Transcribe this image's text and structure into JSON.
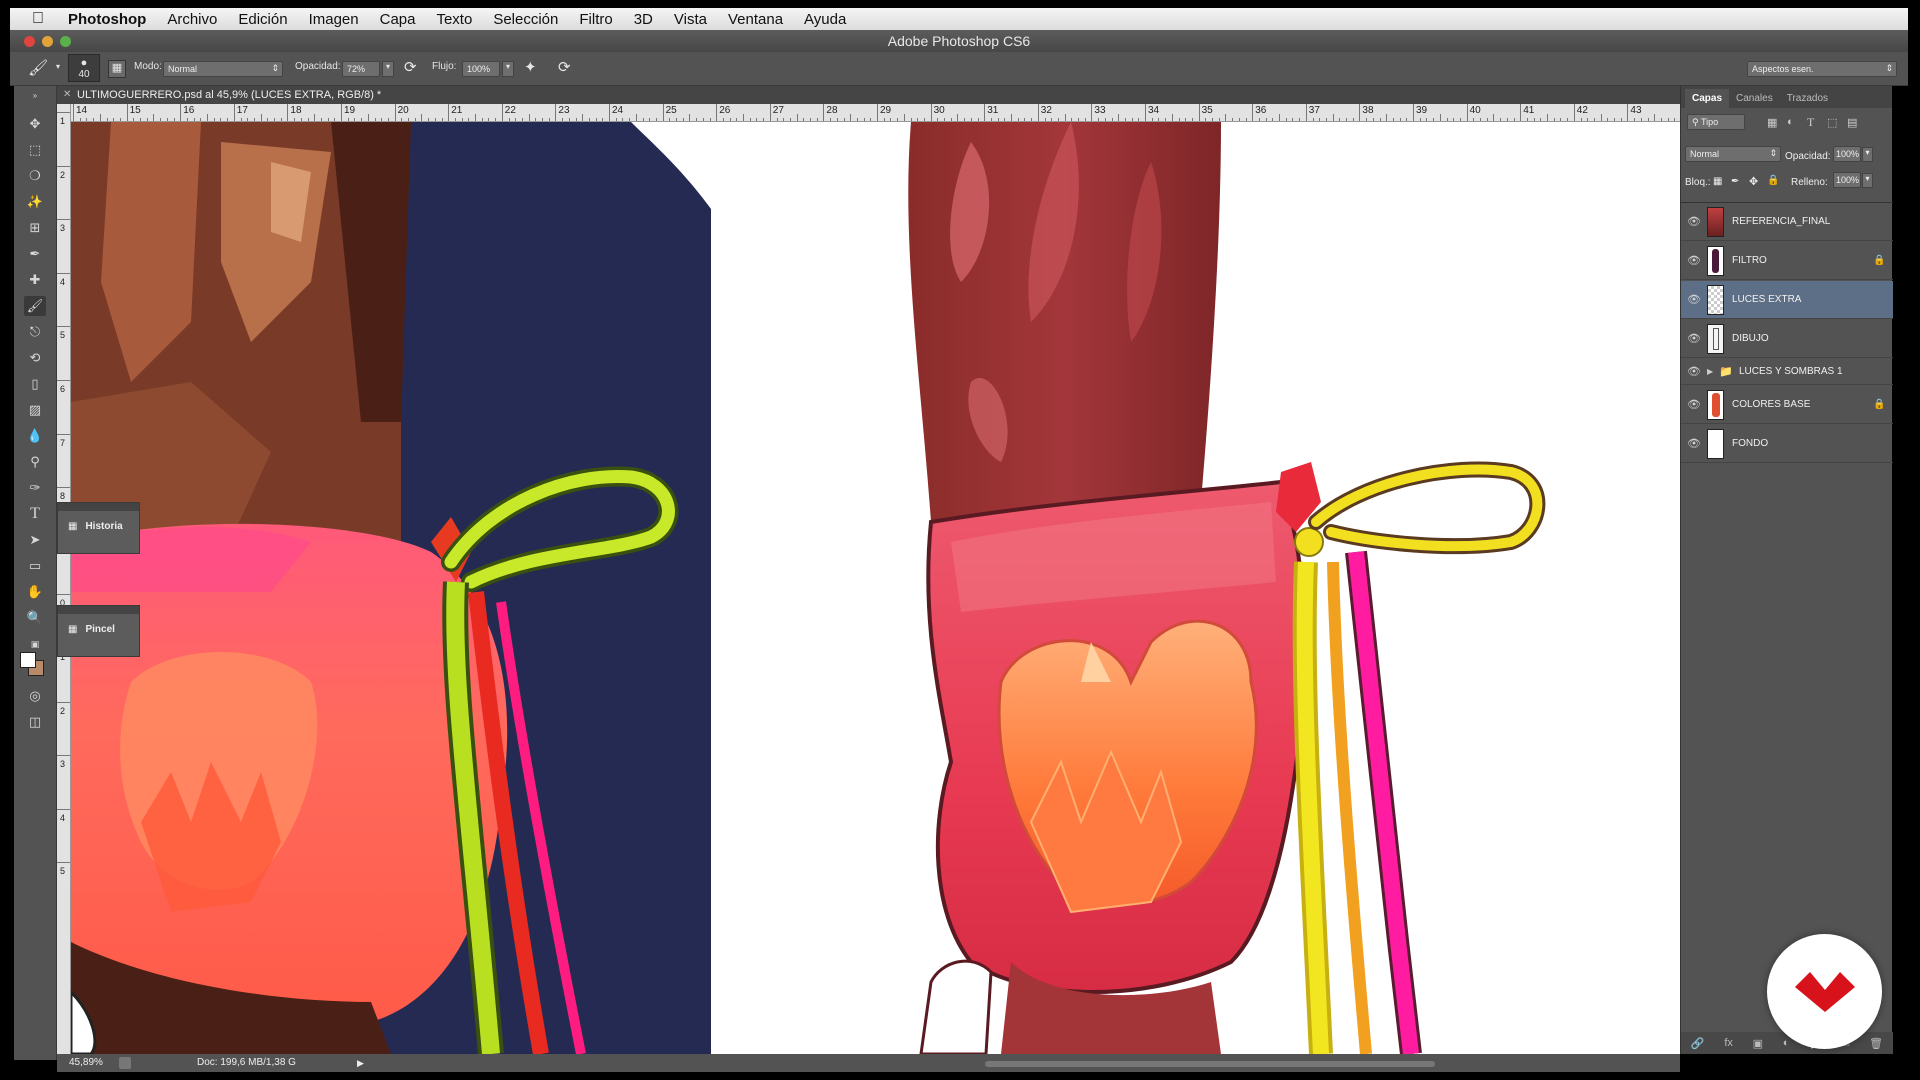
{
  "menubar": {
    "app": "Photoshop",
    "items": [
      "Archivo",
      "Edición",
      "Imagen",
      "Capa",
      "Texto",
      "Selección",
      "Filtro",
      "3D",
      "Vista",
      "Ventana",
      "Ayuda"
    ]
  },
  "window": {
    "title": "Adobe Photoshop CS6"
  },
  "options": {
    "brush_size": "40",
    "mode_label": "Modo:",
    "mode_value": "Normal",
    "opacity_label": "Opacidad:",
    "opacity_value": "72%",
    "flow_label": "Flujo:",
    "flow_value": "100%",
    "workspace": "Aspectos esen."
  },
  "document": {
    "tab_title": "ULTIMOGUERRERO.psd al 45,9% (LUCES EXTRA, RGB/8) *",
    "ruler_labels": [
      "14",
      "15",
      "16",
      "17",
      "18",
      "19",
      "20",
      "21",
      "22",
      "23",
      "24",
      "25",
      "26",
      "27",
      "28",
      "29",
      "30",
      "31",
      "32",
      "33",
      "34",
      "35",
      "36",
      "37",
      "38",
      "39",
      "40",
      "41",
      "42",
      "43"
    ],
    "ruler_left_labels": [
      "1",
      "2",
      "3",
      "4",
      "5",
      "6",
      "7",
      "8",
      "9",
      "0",
      "1",
      "2",
      "3",
      "4",
      "5"
    ]
  },
  "panels": {
    "historia": "Historia",
    "pincel": "Pincel"
  },
  "status": {
    "zoom": "45,89%",
    "doc": "Doc: 199,6 MB/1,38 G"
  },
  "layers_panel": {
    "tabs": [
      "Capas",
      "Canales",
      "Trazados"
    ],
    "filter": "Tipo",
    "blend_mode": "Normal",
    "opacity_label": "Opacidad:",
    "opacity_value": "100%",
    "lock_label": "Bloq.:",
    "fill_label": "Relleno:",
    "fill_value": "100%",
    "layers": [
      {
        "name": "REFERENCIA_FINAL",
        "locked": false,
        "selected": false
      },
      {
        "name": "FILTRO",
        "locked": true,
        "selected": false
      },
      {
        "name": "LUCES EXTRA",
        "locked": false,
        "selected": true
      },
      {
        "name": "DIBUJO",
        "locked": false,
        "selected": false
      },
      {
        "name": "LUCES Y SOMBRAS 1",
        "locked": false,
        "selected": false,
        "group": true
      },
      {
        "name": "COLORES BASE",
        "locked": true,
        "selected": false
      },
      {
        "name": "FONDO",
        "locked": false,
        "selected": false
      }
    ]
  },
  "colors": {
    "navy_bg": "#252a52",
    "skin_dark": "#7a3a28",
    "cuff_pink": "#f04a5e",
    "cuff_orange": "#ff7a40",
    "cord_green": "#c8e82a",
    "cord_yellow": "#f2e020",
    "cord_magenta": "#ff1ca0",
    "arm_red": "#9e3236",
    "accent_red": "#d7121b"
  }
}
